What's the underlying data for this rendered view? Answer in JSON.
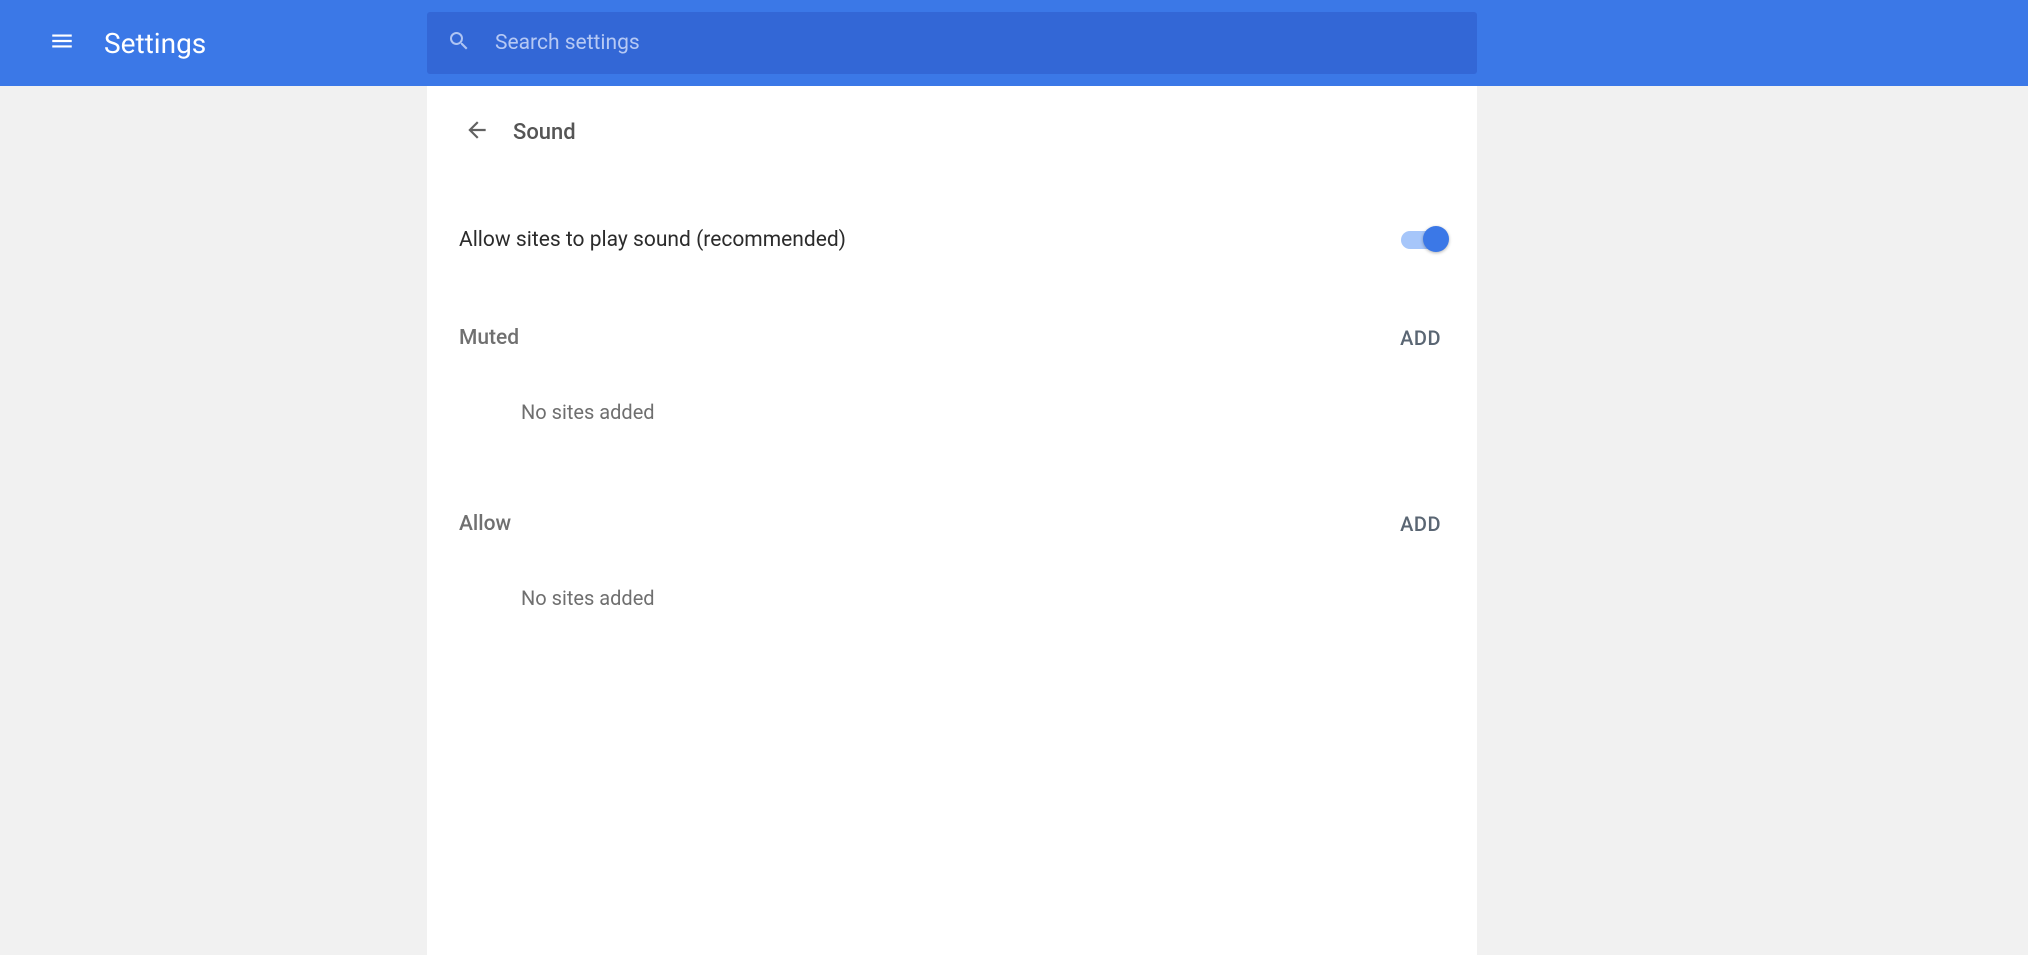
{
  "header": {
    "app_title": "Settings",
    "search_placeholder": "Search settings"
  },
  "page": {
    "title": "Sound",
    "toggle": {
      "label": "Allow sites to play sound (recommended)",
      "value": true
    },
    "sections": {
      "muted": {
        "title": "Muted",
        "add_label": "ADD",
        "empty_text": "No sites added"
      },
      "allow": {
        "title": "Allow",
        "add_label": "ADD",
        "empty_text": "No sites added"
      }
    }
  }
}
